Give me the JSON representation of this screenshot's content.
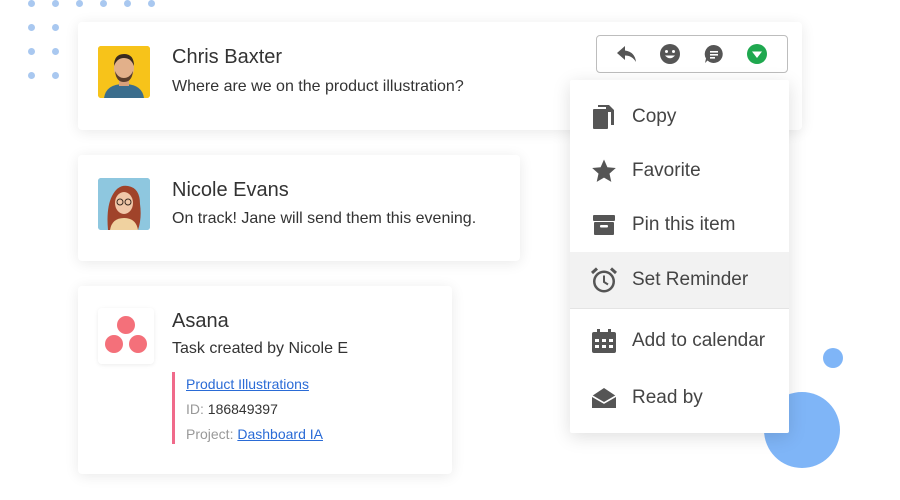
{
  "messages": [
    {
      "name": "Chris Baxter",
      "text": "Where are we on the product illustration?"
    },
    {
      "name": "Nicole Evans",
      "text": "On track! Jane will send them this evening."
    }
  ],
  "asana": {
    "name": "Asana",
    "text": "Task created by Nicole E",
    "task_link": "Product Illustrations",
    "id_label": "ID:",
    "id_value": "186849397",
    "project_label": "Project:",
    "project_link": "Dashboard IA"
  },
  "toolbar": {
    "icons": [
      "reply-icon",
      "emoji-icon",
      "comment-icon",
      "dropdown-icon"
    ]
  },
  "menu": {
    "items": [
      {
        "label": "Copy",
        "icon": "copy-icon"
      },
      {
        "label": "Favorite",
        "icon": "star-icon"
      },
      {
        "label": "Pin this item",
        "icon": "pin-archive-icon"
      },
      {
        "label": "Set Reminder",
        "icon": "alarm-clock-icon",
        "active": true
      },
      {
        "label": "Add to calendar",
        "icon": "calendar-icon"
      },
      {
        "label": "Read by",
        "icon": "open-envelope-icon"
      }
    ]
  },
  "colors": {
    "accent_green": "#1fa84f",
    "task_border": "#f06a8a",
    "link": "#2a6bd6",
    "decor_blue": "#7fb5f7",
    "avatar_yellow": "#f7c31a",
    "avatar_blue": "#8ec7df"
  }
}
